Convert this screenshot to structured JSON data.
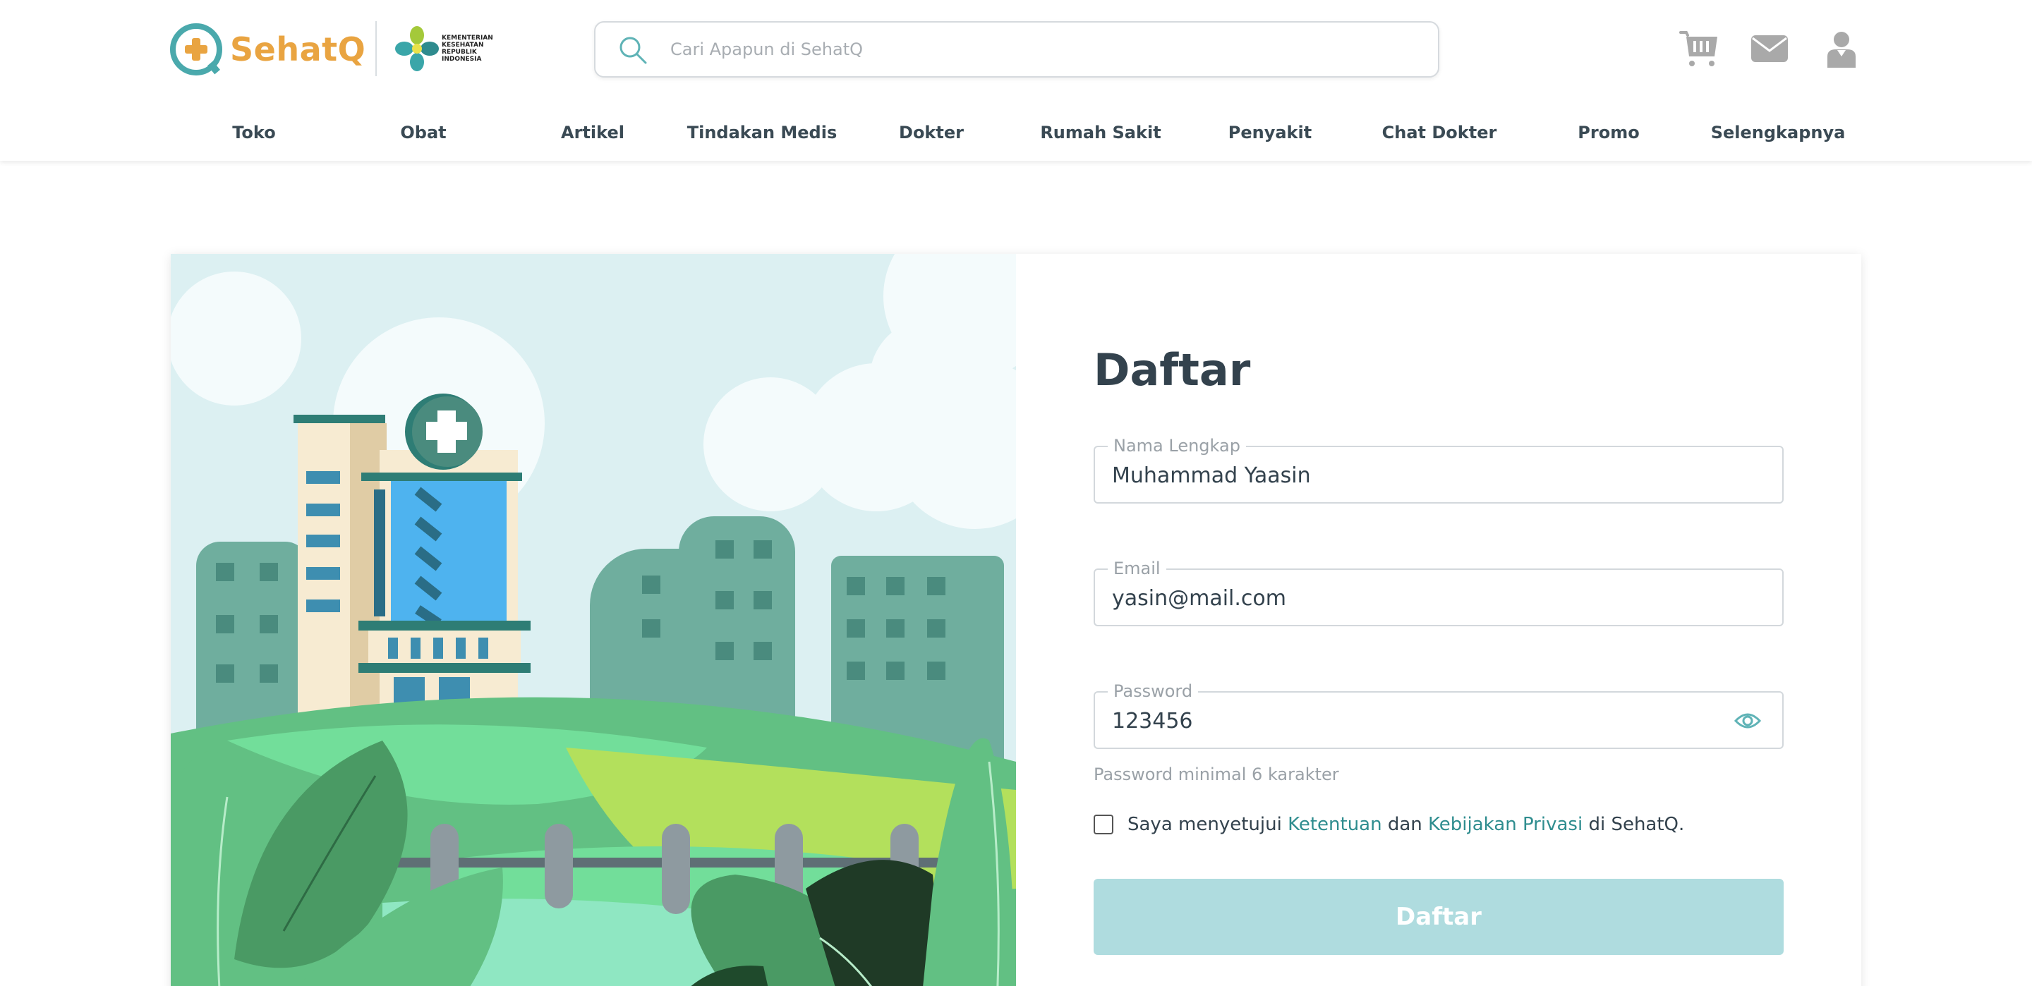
{
  "header": {
    "brand_name": "SehatQ",
    "partner_logo_lines": [
      "KEMENTERIAN",
      "KESEHATAN",
      "REPUBLIK",
      "INDONESIA"
    ],
    "search": {
      "placeholder": "Cari Apapun di SehatQ",
      "value": ""
    },
    "icons": [
      "cart-icon",
      "mail-icon",
      "user-icon"
    ]
  },
  "nav": {
    "items": [
      {
        "label": "Toko"
      },
      {
        "label": "Obat"
      },
      {
        "label": "Artikel"
      },
      {
        "label": "Tindakan Medis"
      },
      {
        "label": "Dokter"
      },
      {
        "label": "Rumah Sakit"
      },
      {
        "label": "Penyakit"
      },
      {
        "label": "Chat Dokter"
      },
      {
        "label": "Promo"
      },
      {
        "label": "Selengkapnya"
      }
    ]
  },
  "form": {
    "title": "Daftar",
    "name_field": {
      "label": "Nama Lengkap",
      "value": "Muhammad Yaasin"
    },
    "email_field": {
      "label": "Email",
      "value": "yasin@mail.com"
    },
    "password_field": {
      "label": "Password",
      "value": "123456"
    },
    "password_hint": "Password minimal 6 karakter",
    "agreement": {
      "checked": false,
      "prefix": "Saya menyetujui",
      "terms_link": "Ketentuan",
      "conjunction": "dan",
      "privacy_link": "Kebijakan Privasi",
      "suffix": "di SehatQ."
    },
    "submit_label": "Daftar"
  },
  "colors": {
    "brand_orange": "#e9a441",
    "brand_teal": "#3aa6a9",
    "link": "#2f8d8f",
    "submit_disabled": "#afdcdf",
    "text_dark": "#33424d"
  }
}
